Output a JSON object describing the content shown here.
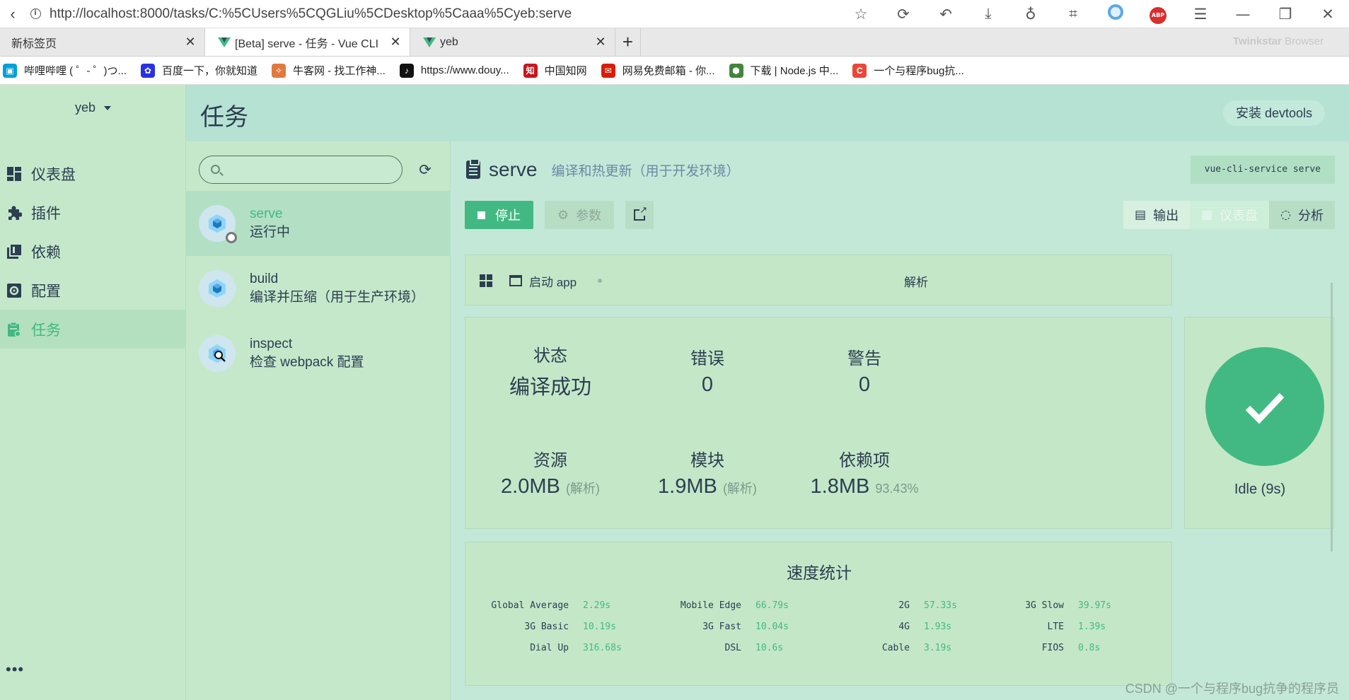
{
  "browser": {
    "url": "http://localhost:8000/tasks/C:%5CUsers%5CQGLiu%5CDesktop%5Caaa%5Cyeb:serve",
    "tabs": [
      {
        "title": "新标签页"
      },
      {
        "title": "[Beta] serve - 任务 - Vue CLI"
      },
      {
        "title": "yeb"
      }
    ],
    "brand": "Twinkstar",
    "brand_suffix": " Browser",
    "bookmarks": [
      {
        "label": "哔哩哔哩 ( ゜- ゜)つ...",
        "color": "#00a1d6"
      },
      {
        "label": "百度一下，你就知道",
        "color": "#2932e1"
      },
      {
        "label": "牛客网 - 找工作神...",
        "color": "#e07a3f"
      },
      {
        "label": "https://www.douy...",
        "color": "#111111"
      },
      {
        "label": "中国知网",
        "color": "#c8161d"
      },
      {
        "label": "网易免费邮箱 - 你...",
        "color": "#d81e06"
      },
      {
        "label": "下载 | Node.js 中...",
        "color": "#43853d"
      },
      {
        "label": "一个与程序bug抗...",
        "color": "#e8483a"
      }
    ]
  },
  "sidebar": {
    "project": "yeb",
    "items": [
      {
        "label": "仪表盘",
        "icon": "dashboard-icon"
      },
      {
        "label": "插件",
        "icon": "puzzle-icon"
      },
      {
        "label": "依赖",
        "icon": "library-icon"
      },
      {
        "label": "配置",
        "icon": "settings-icon"
      },
      {
        "label": "任务",
        "icon": "tasks-icon"
      }
    ],
    "more": "•••"
  },
  "topbar": {
    "title": "任务",
    "devtools": "安装 devtools"
  },
  "tasks": [
    {
      "name": "serve",
      "desc": "运行中"
    },
    {
      "name": "build",
      "desc": "编译并压缩（用于生产环境）"
    },
    {
      "name": "inspect",
      "desc": "检查 webpack 配置"
    }
  ],
  "detail": {
    "name": "serve",
    "desc": "编译和热更新（用于开发环境）",
    "command": "vue-cli-service serve",
    "actions": {
      "stop": "停止",
      "params": "参数"
    },
    "views": [
      {
        "label": "输出",
        "icon": "terminal-icon"
      },
      {
        "label": "仪表盘",
        "icon": "dashboard-icon"
      },
      {
        "label": "分析",
        "icon": "donut-icon"
      }
    ],
    "toolbar": {
      "launch": "启动 app",
      "analyze": "解析"
    },
    "stats": {
      "status_label": "状态",
      "status_value": "编译成功",
      "errors_label": "错误",
      "errors_value": "0",
      "warnings_label": "警告",
      "warnings_value": "0",
      "assets_label": "资源",
      "assets_value": "2.0MB",
      "assets_note": "(解析)",
      "modules_label": "模块",
      "modules_value": "1.9MB",
      "modules_note": "(解析)",
      "deps_label": "依赖项",
      "deps_value": "1.8MB",
      "deps_note": "93.43%"
    },
    "idle": "Idle (9s)",
    "speed": {
      "title": "速度统计",
      "rows": [
        [
          {
            "name": "Global Average",
            "value": "2.29s"
          },
          {
            "name": "Mobile Edge",
            "value": "66.79s"
          },
          {
            "name": "2G",
            "value": "57.33s"
          },
          {
            "name": "3G Slow",
            "value": "39.97s"
          }
        ],
        [
          {
            "name": "3G Basic",
            "value": "10.19s"
          },
          {
            "name": "3G Fast",
            "value": "10.04s"
          },
          {
            "name": "4G",
            "value": "1.93s"
          },
          {
            "name": "LTE",
            "value": "1.39s"
          }
        ],
        [
          {
            "name": "Dial Up",
            "value": "316.68s"
          },
          {
            "name": "DSL",
            "value": "10.6s"
          },
          {
            "name": "Cable",
            "value": "3.19s"
          },
          {
            "name": "FIOS",
            "value": "0.8s"
          }
        ]
      ]
    }
  },
  "watermark": "CSDN @一个与程序bug抗争的程序员",
  "colors": {
    "accent": "#42b983",
    "sidebar": "#c5e8cb",
    "topbar": "#b6e2d4"
  }
}
